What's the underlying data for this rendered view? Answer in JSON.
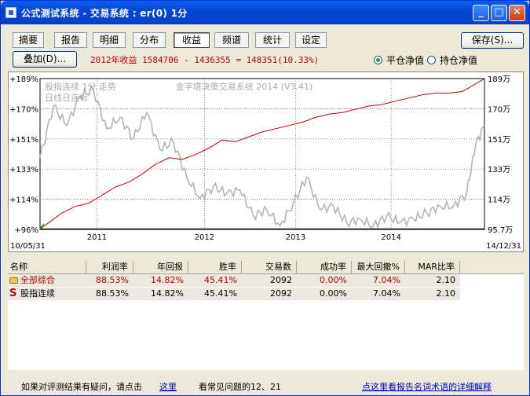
{
  "window": {
    "title": "公式测试系统 - 交易系统 : er(0) 1分"
  },
  "titlebar_buttons": {
    "minimize": "_",
    "maximize": "□",
    "close": "✕"
  },
  "tabs": [
    "摘要",
    "报告",
    "明细",
    "分布",
    "收益",
    "频谱",
    "统计",
    "设定"
  ],
  "active_tab": 4,
  "toolbar": {
    "save_label": "保存(S)...",
    "overlay_label": "叠加(D)..."
  },
  "summary_text": "2012年收益 1584706 - 1436355 = 148351(10.33%)",
  "radio": {
    "flat_label": "平仓净值",
    "hold_label": "持仓净值",
    "selected": "flat"
  },
  "chart_data": {
    "type": "line",
    "legend": [
      "股指连续 1分 走势",
      "日线日连标"
    ],
    "watermark": "金字塔决策交易系统 2014 (V3.41)",
    "left_ticks": [
      "+189%",
      "+170%",
      "+151%",
      "+133%",
      "+114%",
      "+96%"
    ],
    "right_ticks": [
      "189万",
      "170万",
      "151万",
      "133万",
      "114万",
      "95.7万"
    ],
    "x_ticks": [
      "2011",
      "2012",
      "2013",
      "2014"
    ],
    "x_start": "10/05/31",
    "x_end": "14/12/31",
    "ylim": [
      95.7,
      189
    ],
    "colors": {
      "equity": "#C80000",
      "price": "#B4B4B4",
      "baseline": "#000000",
      "start_mark": "#00A000"
    },
    "series": [
      {
        "name": "平仓净值",
        "x": [
          0,
          0.02,
          0.05,
          0.08,
          0.11,
          0.14,
          0.17,
          0.2,
          0.23,
          0.26,
          0.29,
          0.32,
          0.35,
          0.38,
          0.41,
          0.44,
          0.47,
          0.5,
          0.53,
          0.56,
          0.59,
          0.62,
          0.65,
          0.68,
          0.71,
          0.74,
          0.77,
          0.8,
          0.83,
          0.86,
          0.89,
          0.92,
          0.95,
          0.97,
          1.0
        ],
        "values": [
          96,
          100,
          106,
          110,
          112,
          117,
          122,
          125,
          130,
          136,
          140,
          139,
          142,
          146,
          151,
          150,
          153,
          156,
          158,
          160,
          162,
          165,
          167,
          168,
          170,
          172,
          173,
          175,
          177,
          179,
          180,
          180,
          181,
          184,
          189
        ]
      },
      {
        "name": "股指连续",
        "x": [
          0,
          0.03,
          0.06,
          0.09,
          0.12,
          0.15,
          0.18,
          0.21,
          0.24,
          0.27,
          0.3,
          0.33,
          0.36,
          0.39,
          0.42,
          0.45,
          0.48,
          0.51,
          0.54,
          0.57,
          0.6,
          0.63,
          0.66,
          0.69,
          0.72,
          0.75,
          0.78,
          0.81,
          0.84,
          0.87,
          0.9,
          0.93,
          0.96,
          0.98,
          1.0
        ],
        "values": [
          140,
          172,
          160,
          178,
          182,
          158,
          165,
          152,
          168,
          145,
          150,
          128,
          115,
          122,
          118,
          120,
          104,
          108,
          98,
          112,
          128,
          108,
          110,
          100,
          102,
          98,
          104,
          100,
          102,
          106,
          110,
          110,
          118,
          148,
          160
        ]
      }
    ]
  },
  "table": {
    "columns": [
      "名称",
      "利润率",
      "年回报",
      "胜率",
      "交易数",
      "成功率",
      "最大回撤%",
      "MAR比率"
    ],
    "rows": [
      {
        "icon": "folder-icon",
        "name": "全部综合",
        "values": [
          "88.53%",
          "14.82%",
          "45.41%",
          "2092",
          "0.00%",
          "7.04%",
          "2.10"
        ]
      },
      {
        "icon": "s-icon",
        "icon_char": "S",
        "name": "股指连续",
        "values": [
          "88.53%",
          "14.82%",
          "45.41%",
          "2092",
          "0.00%",
          "7.04%",
          "2.10"
        ]
      }
    ]
  },
  "footer": {
    "question": "如果对评测结果有疑问，请点击",
    "here_link": "这里",
    "faq": "看常见问题的12、21",
    "glossary_link": "点这里看报告名词术语的详细解释"
  }
}
